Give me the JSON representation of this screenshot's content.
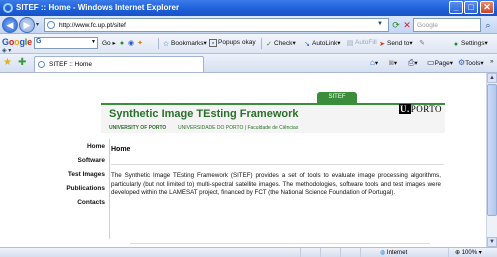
{
  "window": {
    "title": "SITEF :: Home - Windows Internet Explorer",
    "controls": {
      "minimize": "_",
      "maximize": "□",
      "close": "✕"
    }
  },
  "address": {
    "url": "http://www.fc.up.pt/sitef",
    "search_placeholder": "Google"
  },
  "google_toolbar": {
    "logo": {
      "G": "G",
      "o1": "o",
      "o2": "o",
      "g": "g",
      "l": "l",
      "e": "e"
    },
    "go_label": "Go",
    "bookmarks_label": "Bookmarks",
    "popups_label": "Popups okay",
    "check_label": "Check",
    "autolink_label": "AutoLink",
    "autofill_label": "AutoFill",
    "sendto_label": "Send to",
    "settings_label": "Settings"
  },
  "tabs": [
    {
      "label": "SITEF :: Home"
    }
  ],
  "command_bar": {
    "page_label": "Page",
    "tools_label": "Tools"
  },
  "page": {
    "badge": "SITEF",
    "heading": "Synthetic Image TEsting Framework",
    "university": "UNIVERSITY OF PORTO",
    "faculty": "UNIVERSIDADE DO PORTO | Faculdade de Ciências",
    "logo_u": "U.",
    "logo_text": "PORTO",
    "nav": [
      {
        "label": "Home"
      },
      {
        "label": "Software"
      },
      {
        "label": "Test Images"
      },
      {
        "label": "Publications"
      },
      {
        "label": "Contacts"
      }
    ],
    "section_title": "Home",
    "body": "The Synthetic Image TEsting Framework (SITEF) provides a set of tools to evaluate image processing algorithms, particularly (but not limited to) multi-spectral satellite images. The methodologies, software tools and test images were developed within the LAMESAT project, financed by FCT (the National Science Foundation of Portugal)."
  },
  "status": {
    "zone": "Internet",
    "zoom": "100%"
  },
  "icons": [
    "ie-icon",
    "back-icon",
    "forward-icon",
    "refresh-icon",
    "stop-icon",
    "search-icon",
    "favorites-star-icon",
    "add-favorites-icon",
    "home-icon",
    "feeds-icon",
    "print-icon",
    "globe-icon"
  ],
  "colors": {
    "title_blue": "#1d5ed8",
    "sitef_green": "#3b8d3b",
    "heading_green": "#2a6f2a"
  }
}
